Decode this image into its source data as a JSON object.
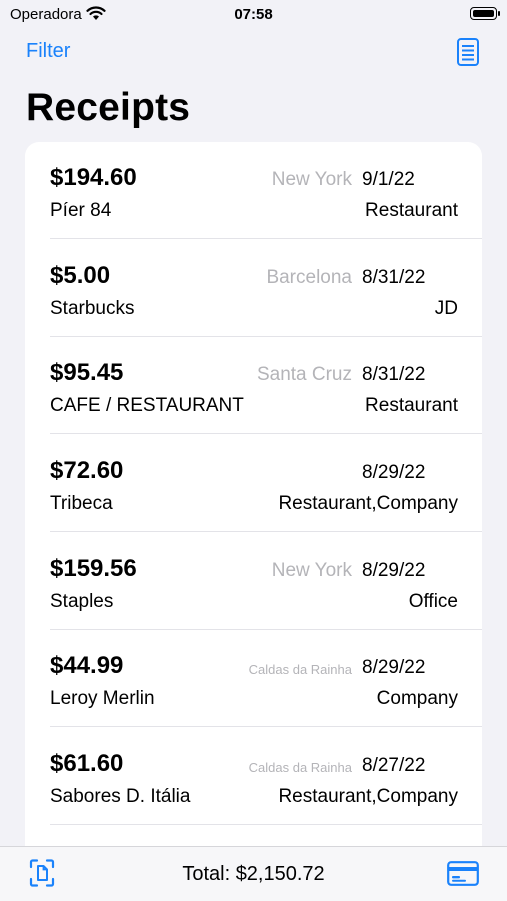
{
  "status_bar": {
    "carrier": "Operadora",
    "time": "07:58"
  },
  "nav": {
    "filter_label": "Filter",
    "list_icon": "list-icon"
  },
  "title": "Receipts",
  "receipts": [
    {
      "amount": "$194.60",
      "merchant": "Píer 84",
      "city": "New York",
      "date": "9/1/22",
      "category": "Restaurant"
    },
    {
      "amount": "$5.00",
      "merchant": "Starbucks",
      "city": "Barcelona",
      "date": "8/31/22",
      "category": "JD"
    },
    {
      "amount": "$95.45",
      "merchant": "CAFE / RESTAURANT",
      "city": "Santa Cruz",
      "date": "8/31/22",
      "category": "Restaurant"
    },
    {
      "amount": "$72.60",
      "merchant": "Tribeca",
      "city": "",
      "date": "8/29/22",
      "category": "Restaurant,Company"
    },
    {
      "amount": "$159.56",
      "merchant": "Staples",
      "city": "New York",
      "date": "8/29/22",
      "category": "Office"
    },
    {
      "amount": "$44.99",
      "merchant": "Leroy Merlin",
      "city": "Caldas da Rainha",
      "date": "8/29/22",
      "category": "Company"
    },
    {
      "amount": "$61.60",
      "merchant": "Sabores D. Itália",
      "city": "Caldas da Rainha",
      "date": "8/27/22",
      "category": "Restaurant,Company"
    }
  ],
  "toolbar": {
    "total": "Total: $2,150.72",
    "scan_icon": "scan-document-icon",
    "card_icon": "credit-card-icon"
  },
  "colors": {
    "accent": "#1a82fb",
    "background": "#f2f2f7",
    "secondary_text": "#b4b4b8"
  }
}
